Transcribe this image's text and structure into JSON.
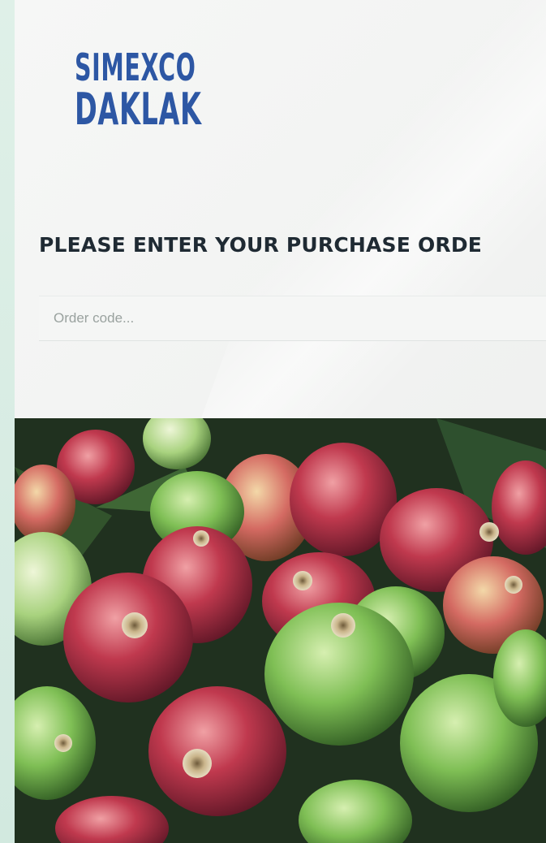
{
  "brand": {
    "logo_line1": "SIMEXCO",
    "logo_line2": "DAKLAK",
    "accent_color": "#2d57a4"
  },
  "order_form": {
    "prompt": "PLEASE ENTER YOUR PURCHASE ORDE",
    "input_placeholder": "Order code...",
    "input_value": ""
  },
  "hero_image": {
    "subject": "coffee-cherries-image"
  }
}
